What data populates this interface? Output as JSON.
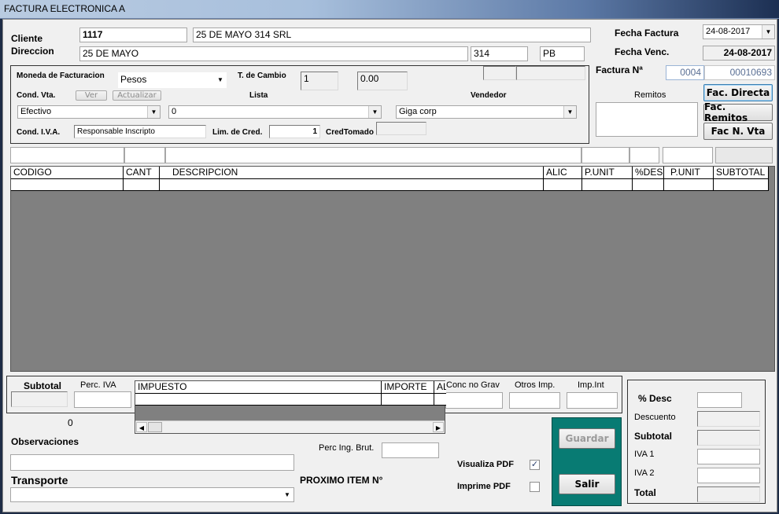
{
  "window": {
    "title": "FACTURA ELECTRONICA A"
  },
  "header": {
    "cliente_label": "Cliente",
    "cliente_code": "1117",
    "cliente_name": "25 DE MAYO 314 SRL",
    "direccion_label": "Direccion",
    "direccion_street": "25 DE MAYO",
    "direccion_number": "314",
    "direccion_floor": "PB",
    "fecha_factura_label": "Fecha Factura",
    "fecha_factura": "24-08-2017",
    "fecha_venc_label": "Fecha Venc.",
    "fecha_venc": "24-08-2017",
    "factura_label": "Factura Nª",
    "factura_pto": "0004",
    "factura_num": "00010693",
    "remitos_label": "Remitos"
  },
  "billing": {
    "moneda_label": "Moneda de Facturacion",
    "moneda": "Pesos",
    "tcambio_label": "T. de Cambio",
    "tcambio_1": "1",
    "tcambio_2": "0.00",
    "cond_vta_label": "Cond. Vta.",
    "ver_label": "Ver",
    "actualizar_label": "Actualizar",
    "lista_label": "Lista",
    "vendedor_label": "Vendedor",
    "cond_vta": "Efectivo",
    "lista": "0",
    "vendedor": "Giga corp",
    "cond_iva_label": "Cond. I.V.A.",
    "cond_iva": "Responsable Inscripto",
    "lim_cred_label": "Lim. de Cred.",
    "lim_cred": "1",
    "cred_tomado_label": "CredTomado"
  },
  "buttons": {
    "fac_directa": "Fac. Directa",
    "fac_remitos": "Fac. Remitos",
    "fac_nvta": "Fac N. Vta",
    "guardar": "Guardar",
    "salir": "Salir"
  },
  "items_grid": {
    "columns": [
      "CODIGO",
      "CANT",
      "DESCRIPCION",
      "ALIC",
      "P.UNIT",
      "%DES",
      "P.UNIT",
      "SUBTOTAL"
    ]
  },
  "footer": {
    "subtotal_label": "Subtotal",
    "perc_iva_label": "Perc. IVA",
    "zero_value": "0",
    "tax_columns": [
      "IMPUESTO",
      "IMPORTE",
      "AL"
    ],
    "conc_no_grav_label": "Conc no Grav",
    "otros_imp_label": "Otros Imp.",
    "imp_int_label": "Imp.Int",
    "observaciones_label": "Observaciones",
    "perc_ing_brut_label": "Perc  Ing. Brut.",
    "transporte_label": "Transporte",
    "proximo_item_label": "PROXIMO ITEM  N°",
    "visualiza_pdf_label": "Visualiza PDF",
    "imprime_pdf_label": "Imprime PDF",
    "check_mark": "✓"
  },
  "totals": {
    "desc_pct_label": "% Desc",
    "descuento_label": "Descuento",
    "subtotal_label": "Subtotal",
    "iva1_label": "IVA 1",
    "iva2_label": "IVA 2",
    "total_label": "Total"
  },
  "colors": {
    "grid_bg": "#808080",
    "action_panel": "#087b73"
  }
}
